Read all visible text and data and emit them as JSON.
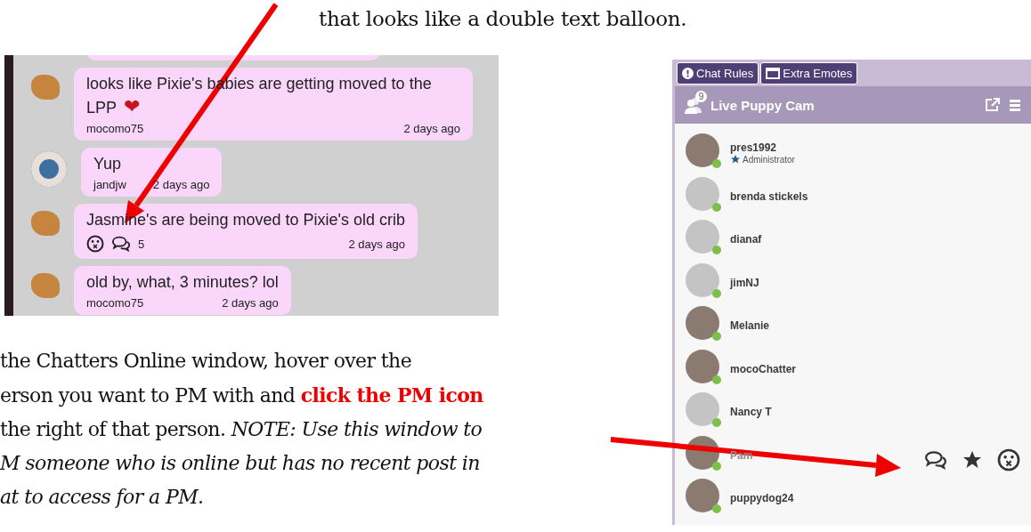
{
  "caption": "that looks like a double text balloon.",
  "chat_log": {
    "messages": [
      {
        "kind": "sprite",
        "text": "looks like Pixie's babies are getting moved to the LPP",
        "emoji": "❤",
        "user": "mocomo75",
        "time": "2 days ago"
      },
      {
        "kind": "photo",
        "text": "Yup",
        "user": "jandjw",
        "time": "2 days ago"
      },
      {
        "kind": "sprite",
        "text": "Jasmine's are being moved to Pixie's old crib",
        "reply_count": "5",
        "time": "2 days ago"
      },
      {
        "kind": "sprite",
        "text": "old by, what, 3 minutes? lol",
        "user": "mocomo75",
        "time": "2 days ago"
      }
    ]
  },
  "instructions": {
    "lines": [
      "the Chatters Online window, hover over the",
      "erson you want to PM with and **click the PM icon**",
      "the right of that person. *NOTE: Use this window to*",
      "*M someone who is online but has no recent post in*",
      "*at to access for a PM.*"
    ]
  },
  "chatters_panel": {
    "buttons": [
      {
        "kind": "info",
        "label": "Chat Rules"
      },
      {
        "kind": "window",
        "label": "Extra Emotes"
      }
    ],
    "count": "9",
    "title": "Live Puppy Cam",
    "users": [
      {
        "kind": "photo",
        "name": "pres1992",
        "role": "Administrator",
        "online": true,
        "hovered": false
      },
      {
        "kind": "placeholder",
        "name": "brenda stickels",
        "online": true,
        "hovered": false
      },
      {
        "kind": "placeholder",
        "name": "dianaf",
        "online": true,
        "hovered": false
      },
      {
        "kind": "placeholder",
        "name": "jimNJ",
        "online": true,
        "hovered": false
      },
      {
        "kind": "photo",
        "name": "Melanie",
        "online": true,
        "hovered": false
      },
      {
        "kind": "photo",
        "name": "mocoChatter",
        "online": true,
        "hovered": false
      },
      {
        "kind": "placeholder",
        "name": "Nancy T",
        "online": true,
        "hovered": false
      },
      {
        "kind": "photo",
        "name": "Pam",
        "online": true,
        "hovered": true
      },
      {
        "kind": "photo",
        "name": "puppydog24",
        "online": true,
        "hovered": false
      }
    ]
  }
}
